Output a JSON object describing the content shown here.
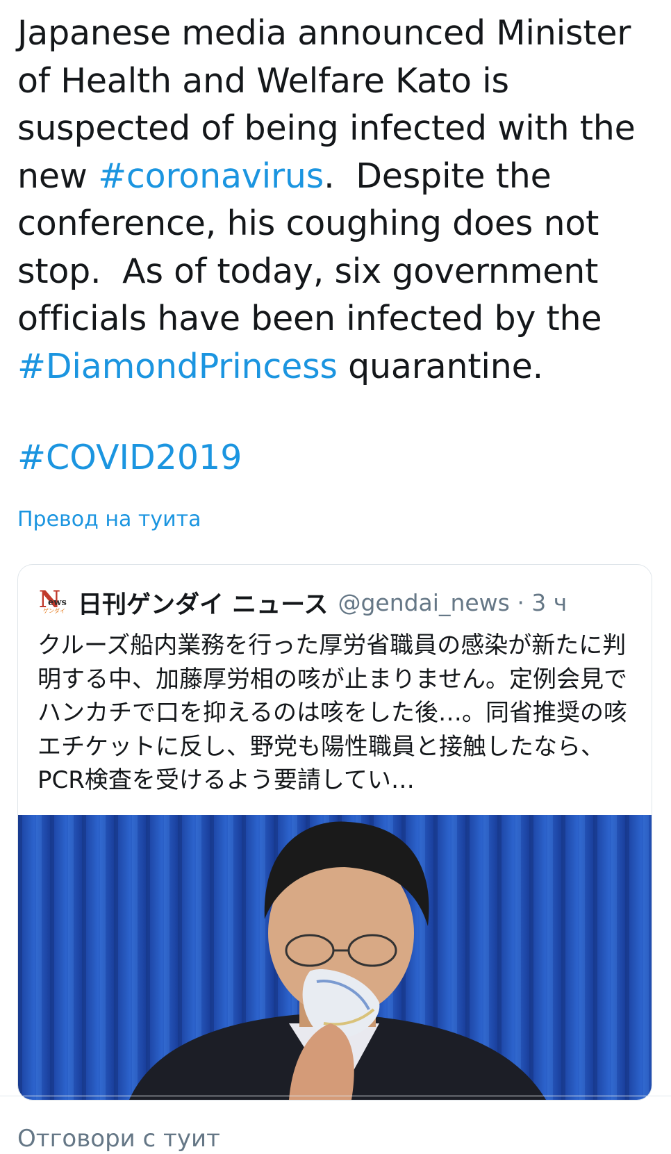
{
  "tweet": {
    "text_part_1": "Japanese media announced Minister of Health and Welfare Kato is suspected of being infected with the new ",
    "hashtag_1": "#coronavirus",
    "text_part_2": ".  Despite the conference, his coughing does not stop.  As of today, six government officials have been infected by the ",
    "hashtag_2": "#DiamondPrincess",
    "text_part_3": " quarantine.",
    "hashtag_3": "#COVID2019",
    "translate_label": "Превод на туита"
  },
  "quoted_tweet": {
    "avatar_letter": "N",
    "avatar_letters_small": "ews",
    "avatar_sub": "ゲンダイ",
    "author_name": "日刊ゲンダイ ニュース",
    "handle_and_time": "@gendai_news · 3 ч",
    "text": "クルーズ船内業務を行った厚労省職員の感染が新たに判明する中、加藤厚労相の咳が止まりません。定例会見でハンカチで口を抑えるのは咳をした後…。同省推奨の咳エチケットに反し、野党も陽性職員と接触したなら、PCR検査を受けるよう要請してい…",
    "image_description": "photo"
  },
  "footer": {
    "reply_label": "Отговори с туит"
  },
  "colors": {
    "link": "#1b95e0",
    "secondary_text": "#657786",
    "curtain_blue": "#1f4fb5"
  }
}
